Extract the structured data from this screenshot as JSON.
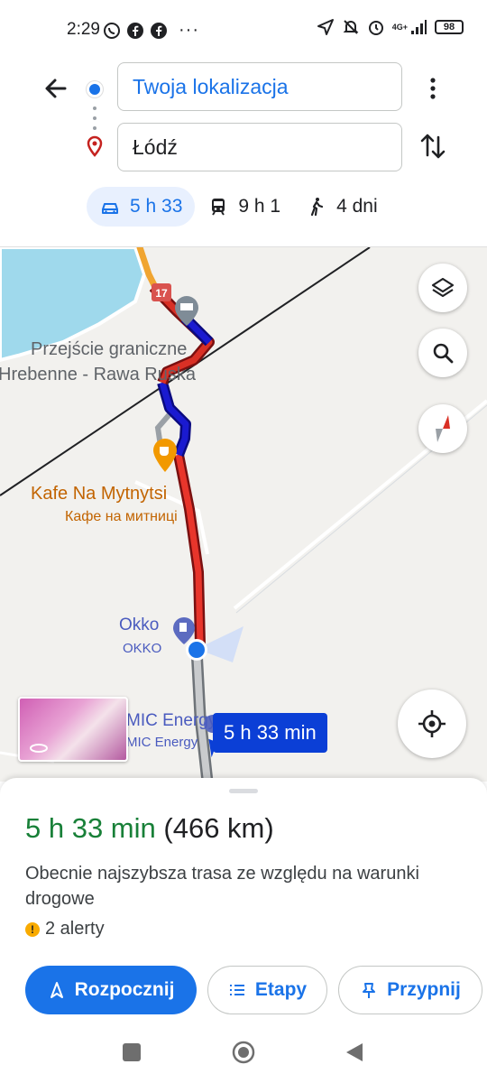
{
  "status_bar": {
    "time": "2:29",
    "left_icons": [
      "whatsapp-icon",
      "facebook-icon",
      "facebook-icon"
    ],
    "more": "···",
    "right_icons": [
      "location-arrow-icon",
      "bell-off-icon",
      "alarm-icon",
      "signal-icon"
    ],
    "network": "4G+",
    "battery": "98"
  },
  "route": {
    "origin": "Twoja lokalizacja",
    "destination": "Łódź"
  },
  "modes": [
    {
      "icon": "car-icon",
      "label": "5 h 33",
      "active": true
    },
    {
      "icon": "train-icon",
      "label": "9 h 1",
      "active": false
    },
    {
      "icon": "walk-icon",
      "label": "4 dni",
      "active": false
    }
  ],
  "map": {
    "road_number": "17",
    "labels": {
      "border_line1": "Przejście graniczne",
      "border_line2": "Hrebenne - Rawa Ruska",
      "cafe_line1": "Kafe Na Mytnytsi",
      "cafe_line2": "Кафе на митниці",
      "okko_line1": "Okko",
      "okko_line2": "OKKO",
      "mic_line1": "MIC Energy",
      "mic_line2": "MIC Energy"
    },
    "eta_callout": "5 h 33 min"
  },
  "summary": {
    "duration": "5 h 33 min",
    "distance": "(466 km)",
    "description": "Obecnie najszybsza trasa ze względu na warunki drogowe",
    "alerts": "2 alerty"
  },
  "actions": {
    "start": "Rozpocznij",
    "steps": "Etapy",
    "pin": "Przypnij"
  },
  "colors": {
    "accent": "#1a73e8",
    "duration_green": "#188038",
    "traffic_red": "#d93025",
    "traffic_blue": "#1a1ad0"
  }
}
